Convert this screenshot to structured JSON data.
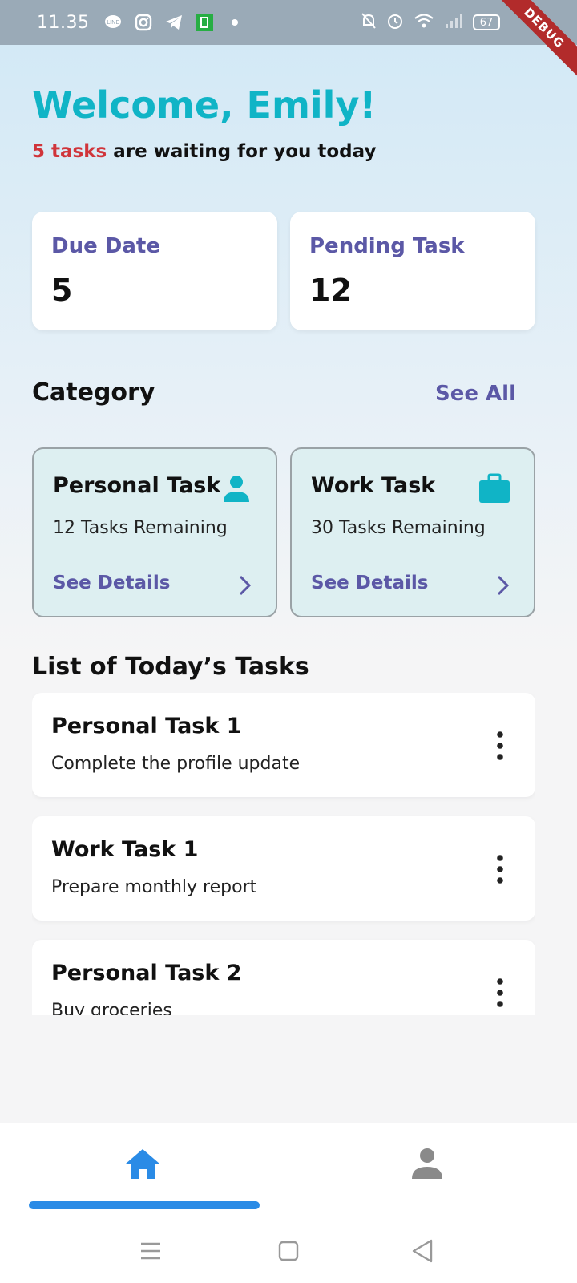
{
  "status_bar": {
    "time": "11.35",
    "battery": "67",
    "icons": [
      "line-app-icon",
      "instagram-icon",
      "telegram-icon",
      "green-app-icon",
      "dot-icon",
      "mute-icon",
      "alarm-icon",
      "wifi-icon",
      "signal-icon",
      "battery-icon",
      "charging-icon"
    ]
  },
  "debug_banner": "DEBUG",
  "header": {
    "welcome": "Welcome, Emily!",
    "subtitle_accent": "5 tasks",
    "subtitle_rest": " are waiting for you today"
  },
  "stats": [
    {
      "label": "Due Date",
      "value": "5"
    },
    {
      "label": "Pending Task",
      "value": "12"
    }
  ],
  "category": {
    "title": "Category",
    "see_all": "See All",
    "cards": [
      {
        "title": "Personal Task",
        "icon": "person-icon",
        "remaining": "12 Tasks Remaining",
        "details": "See Details"
      },
      {
        "title": "Work Task",
        "icon": "briefcase-icon",
        "remaining": "30 Tasks Remaining",
        "details": "See Details"
      }
    ]
  },
  "tasks": {
    "title": "List of Today’s Tasks",
    "items": [
      {
        "title": "Personal Task 1",
        "desc": "Complete the profile update"
      },
      {
        "title": "Work Task 1",
        "desc": "Prepare monthly report"
      },
      {
        "title": "Personal Task 2",
        "desc": "Buy groceries"
      }
    ]
  },
  "bottom_nav": {
    "items": [
      "home-icon",
      "profile-icon"
    ],
    "active": "home-icon"
  },
  "colors": {
    "accent_teal": "#10b4c6",
    "accent_purple": "#5b58a6",
    "accent_red": "#d0343a",
    "nav_blue": "#2a8be6"
  }
}
